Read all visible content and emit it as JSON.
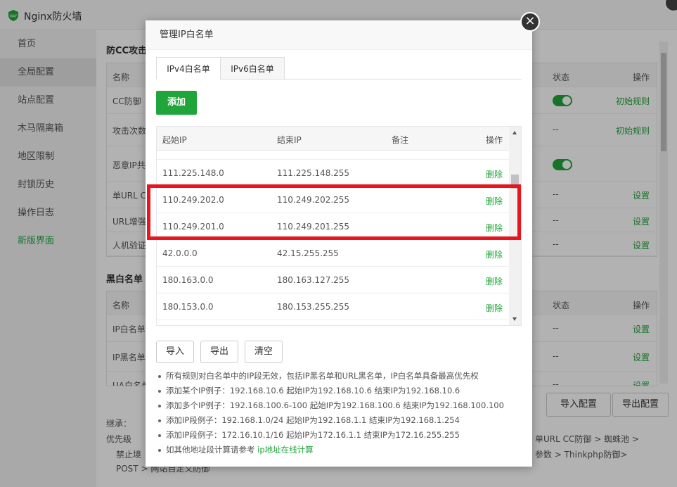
{
  "app": {
    "title": "Nginx防火墙"
  },
  "sidebar": {
    "items": [
      {
        "label": "首页"
      },
      {
        "label": "全局配置"
      },
      {
        "label": "站点配置"
      },
      {
        "label": "木马隔离箱"
      },
      {
        "label": "地区限制"
      },
      {
        "label": "封锁历史"
      },
      {
        "label": "操作日志"
      },
      {
        "label": "新版界面"
      }
    ]
  },
  "background": {
    "section1_title": "防CC攻击",
    "section2_title": "黑白名单",
    "col_name": "名称",
    "col_status": "状态",
    "col_action": "操作",
    "rows1": [
      {
        "name": "CC防御",
        "status": "",
        "action": "初始规则"
      },
      {
        "name": "攻击次数",
        "status": "--",
        "action": "初始规则"
      },
      {
        "name": "恶意IP共",
        "status": "",
        "action": ""
      },
      {
        "name": "单URL C",
        "status": "--",
        "action": "设置"
      },
      {
        "name": "URL增强",
        "status": "--",
        "action": "设置"
      },
      {
        "name": "人机验证",
        "status": "--",
        "action": "设置"
      }
    ],
    "rows2": [
      {
        "name": "IP白名单",
        "status": "--",
        "action": "设置"
      },
      {
        "name": "IP黑名单",
        "status": "--",
        "action": "设置"
      },
      {
        "name": "UA白名单",
        "status": "--",
        "action": "设置"
      }
    ],
    "import_config": "导入配置",
    "export_config": "导出配置",
    "note_inherit": "继承：",
    "note_priority": "优先级",
    "note_forbid": "禁止境",
    "note_post": "POST > 网站自定义防御",
    "note_right1": "单URL CC防御 > 蜘蛛池 >",
    "note_right2": "参数 > Thinkphp防御>"
  },
  "modal": {
    "title": "管理IP白名单",
    "close_icon": "×",
    "tabs": [
      {
        "label": "IPv4白名单"
      },
      {
        "label": "IPv6白名单"
      }
    ],
    "add_label": "添加",
    "columns": {
      "start_ip": "起始IP",
      "end_ip": "结束IP",
      "note": "备注",
      "action": "操作"
    },
    "rows": [
      {
        "start": "111.225.148.0",
        "end": "111.225.148.255",
        "note": "",
        "action": "删除"
      },
      {
        "start": "110.249.202.0",
        "end": "110.249.202.255",
        "note": "",
        "action": "删除"
      },
      {
        "start": "110.249.201.0",
        "end": "110.249.201.255",
        "note": "",
        "action": "删除"
      },
      {
        "start": "42.0.0.0",
        "end": "42.15.255.255",
        "note": "",
        "action": "删除"
      },
      {
        "start": "180.163.0.0",
        "end": "180.163.127.255",
        "note": "",
        "action": "删除"
      },
      {
        "start": "180.153.0.0",
        "end": "180.153.255.255",
        "note": "",
        "action": "删除"
      }
    ],
    "import_label": "导入",
    "export_label": "导出",
    "clear_label": "清空",
    "tips": [
      "所有规则对白名单中的IP段无效，包括IP黑名单和URL黑名单，IP白名单具备最高优先权",
      "添加某个IP例子：192.168.10.6 起始IP为192.168.10.6 结束IP为192.168.10.6",
      "添加多个IP例子：192.168.100.6-100 起始IP为192.168.100.6 结束IP为192.168.100.100",
      "添加IP段例子：192.168.1.0/24 起始IP为192.168.1.1 结束IP为192.168.1.254",
      "添加IP段例子：172.16.10.1/16 起始IP为172.16.1.1 结束IP为172.16.255.255"
    ],
    "tip_last_prefix": "如其他地址段计算请参考 ",
    "tip_last_link": "ip地址在线计算"
  },
  "colors": {
    "accent": "#20a53a",
    "highlight": "#e8141e"
  }
}
